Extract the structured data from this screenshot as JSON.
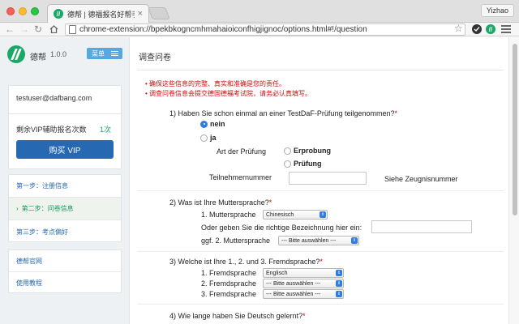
{
  "browser": {
    "tab_title": "德帮 | 德福报名好帮手",
    "tab_close": "×",
    "profile_name": "Yizhao",
    "url": "chrome-extension://bpekbkogncmhmahaioiconfhigjignoc/options.html#!/question",
    "icons": {
      "back": "arrow-left-icon",
      "forward": "arrow-right-icon",
      "reload": "reload-icon",
      "home": "home-icon",
      "bookmark": "star-icon",
      "extension": "extension-icon",
      "menu": "hamburger-icon"
    },
    "colors": {
      "brand_green": "#1aa867",
      "link_blue": "#2768b3",
      "required_red": "#d10b0b"
    }
  },
  "sidebar": {
    "brand": "德帮",
    "version": "1.0.0",
    "menu_button": "菜单",
    "account": {
      "email": "testuser@dafbang.com",
      "vip_label": "剩余VIP辅助报名次数",
      "vip_count": "1次",
      "buy_button": "购买 VIP"
    },
    "steps": [
      {
        "label": "第一步：注册信息"
      },
      {
        "label": "第二步：问卷信息"
      },
      {
        "label": "第三步：考点偏好"
      }
    ],
    "active_step_arrow": "›",
    "links": [
      {
        "label": "德帮官网"
      },
      {
        "label": "使用教程"
      }
    ]
  },
  "main": {
    "page_title": "调查问卷",
    "notices": [
      "确保这些信息的完整、真实和准确是您的责任。",
      "调查问卷信息会提交德国德福考试院，请务必认真填写。"
    ],
    "required_mark": "*",
    "q1": {
      "text": "1) Haben Sie schon einmal an einer TestDaF-Prüfung teilgenommen?",
      "option_no": "nein",
      "option_yes": "ja",
      "selected": "nein",
      "type_label": "Art der Prüfung",
      "type_options": [
        "Erprobung",
        "Prüfung"
      ],
      "number_label": "Teilnehmernummer",
      "number_value": "",
      "hint": "Siehe Zeugnisnummer"
    },
    "q2": {
      "text": "2) Was ist Ihre Muttersprache?",
      "first_label": "1. Muttersprache",
      "first_value": "Chinesisch",
      "other_label": "Oder geben Sie die richtige Bezeichnung hier ein:",
      "other_value": "",
      "second_label": "ggf. 2. Muttersprache",
      "second_value": "--- Bitte auswählen ---"
    },
    "q3": {
      "text": "3) Welche ist Ihre 1., 2. und 3. Fremdsprache?",
      "rows": [
        {
          "label": "1. Fremdsprache",
          "value": "Englisch"
        },
        {
          "label": "2. Fremdsprache",
          "value": "--- Bitte auswählen ---"
        },
        {
          "label": "3. Fremdsprache",
          "value": "--- Bitte auswählen ---"
        }
      ]
    },
    "q4": {
      "text": "4) Wie lange haben Sie Deutsch gelernt?"
    },
    "select_caret": "⇕"
  }
}
